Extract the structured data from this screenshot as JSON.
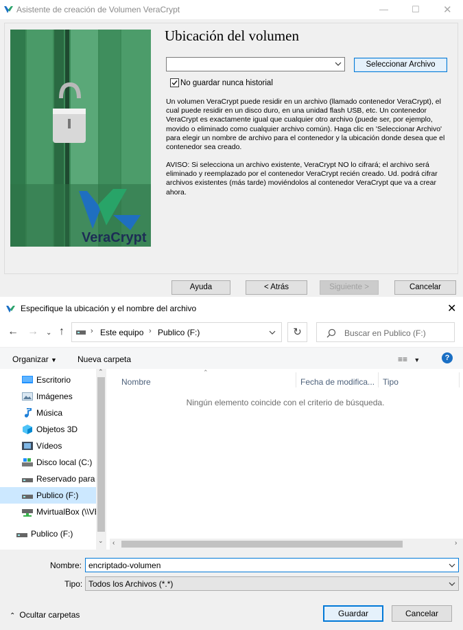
{
  "wizard": {
    "title": "Asistente de creación de Volumen VeraCrypt",
    "heading": "Ubicación del volumen",
    "select_file_label": "Seleccionar Archivo",
    "never_save_history_label": "No guardar nunca historial",
    "never_save_history_checked": true,
    "paragraph1": "Un volumen VeraCrypt puede residir en un archivo (llamado contenedor VeraCrypt), el cual puede residir en un disco duro, en una unidad flash USB, etc. Un contenedor VeraCrypt es exactamente igual que cualquier otro archivo (puede ser, por ejemplo, movido o eliminado como cualquier archivo común). Haga clic en 'Seleccionar Archivo' para elegir un nombre de archivo para el contenedor y la ubicación donde desea que el contenedor sea creado.",
    "paragraph2": "AVISO: Si selecciona un archivo existente, VeraCrypt NO lo cifrará; el archivo será eliminado y reemplazado por el contenedor VeraCrypt recién creado. Ud. podrá cifrar archivos existentes (más tarde) moviéndolos al contenedor VeraCrypt que va a crear ahora.",
    "brand": "VeraCrypt",
    "buttons": {
      "help": "Ayuda",
      "back": "< Atrás",
      "next": "Siguiente >",
      "cancel": "Cancelar"
    }
  },
  "dialog": {
    "title": "Especifique la ubicación y el nombre del archivo",
    "breadcrumb": [
      "Este equipo",
      "Publico (F:)"
    ],
    "search_placeholder": "Buscar en Publico (F:)",
    "organize_label": "Organizar",
    "new_folder_label": "Nueva carpeta",
    "nav_items": [
      {
        "label": "Escritorio",
        "icon": "desktop-icon"
      },
      {
        "label": "Imágenes",
        "icon": "pictures-icon"
      },
      {
        "label": "Música",
        "icon": "music-icon"
      },
      {
        "label": "Objetos 3D",
        "icon": "objects-3d-icon"
      },
      {
        "label": "Vídeos",
        "icon": "videos-icon"
      },
      {
        "label": "Disco local (C:)",
        "icon": "drive-icon"
      },
      {
        "label": "Reservado para el sistema",
        "icon": "drive-icon"
      },
      {
        "label": "Publico (F:)",
        "icon": "drive-icon",
        "selected": true
      },
      {
        "label": "MvirtualBox (\\\\VBoxSvr)",
        "icon": "network-drive-icon"
      }
    ],
    "nav_root_item": {
      "label": "Publico (F:)",
      "icon": "drive-icon"
    },
    "columns": [
      "Nombre",
      "Fecha de modifica...",
      "Tipo"
    ],
    "empty_message": "Ningún elemento coincide con el criterio de búsqueda.",
    "name_label": "Nombre:",
    "name_value": "encriptado-volumen",
    "type_label": "Tipo:",
    "type_value": "Todos los Archivos (*.*)",
    "hide_folders_label": "Ocultar carpetas",
    "save_label": "Guardar",
    "cancel_label": "Cancelar"
  },
  "colors": {
    "accent": "#0078d7",
    "selection": "#cce8ff",
    "help": "#1a6fc4"
  }
}
